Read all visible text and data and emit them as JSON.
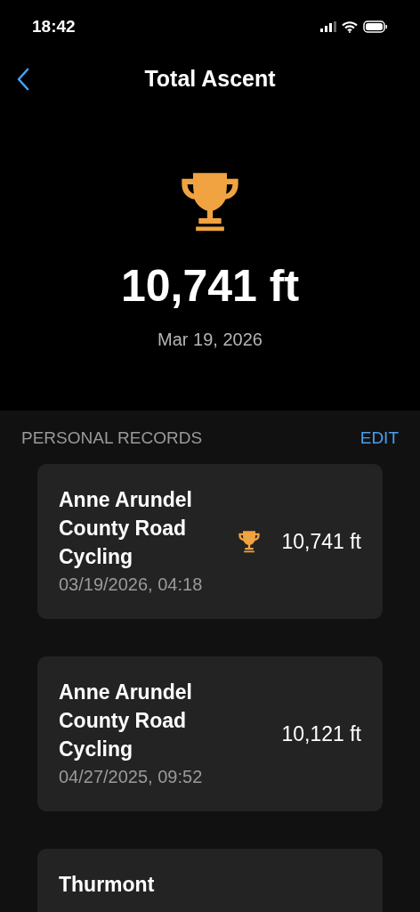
{
  "status_bar": {
    "time": "18:42"
  },
  "nav": {
    "title": "Total Ascent"
  },
  "hero": {
    "value": "10,741 ft",
    "date": "Mar 19, 2026"
  },
  "section": {
    "title": "PERSONAL RECORDS",
    "action": "EDIT"
  },
  "records": [
    {
      "name": "Anne Arundel County Road Cycling",
      "date": "03/19/2026, 04:18",
      "value": "10,741 ft",
      "best": true
    },
    {
      "name": "Anne Arundel County Road Cycling",
      "date": "04/27/2025, 09:52",
      "value": "10,121 ft",
      "best": false
    },
    {
      "name": "Thurmont"
    }
  ]
}
